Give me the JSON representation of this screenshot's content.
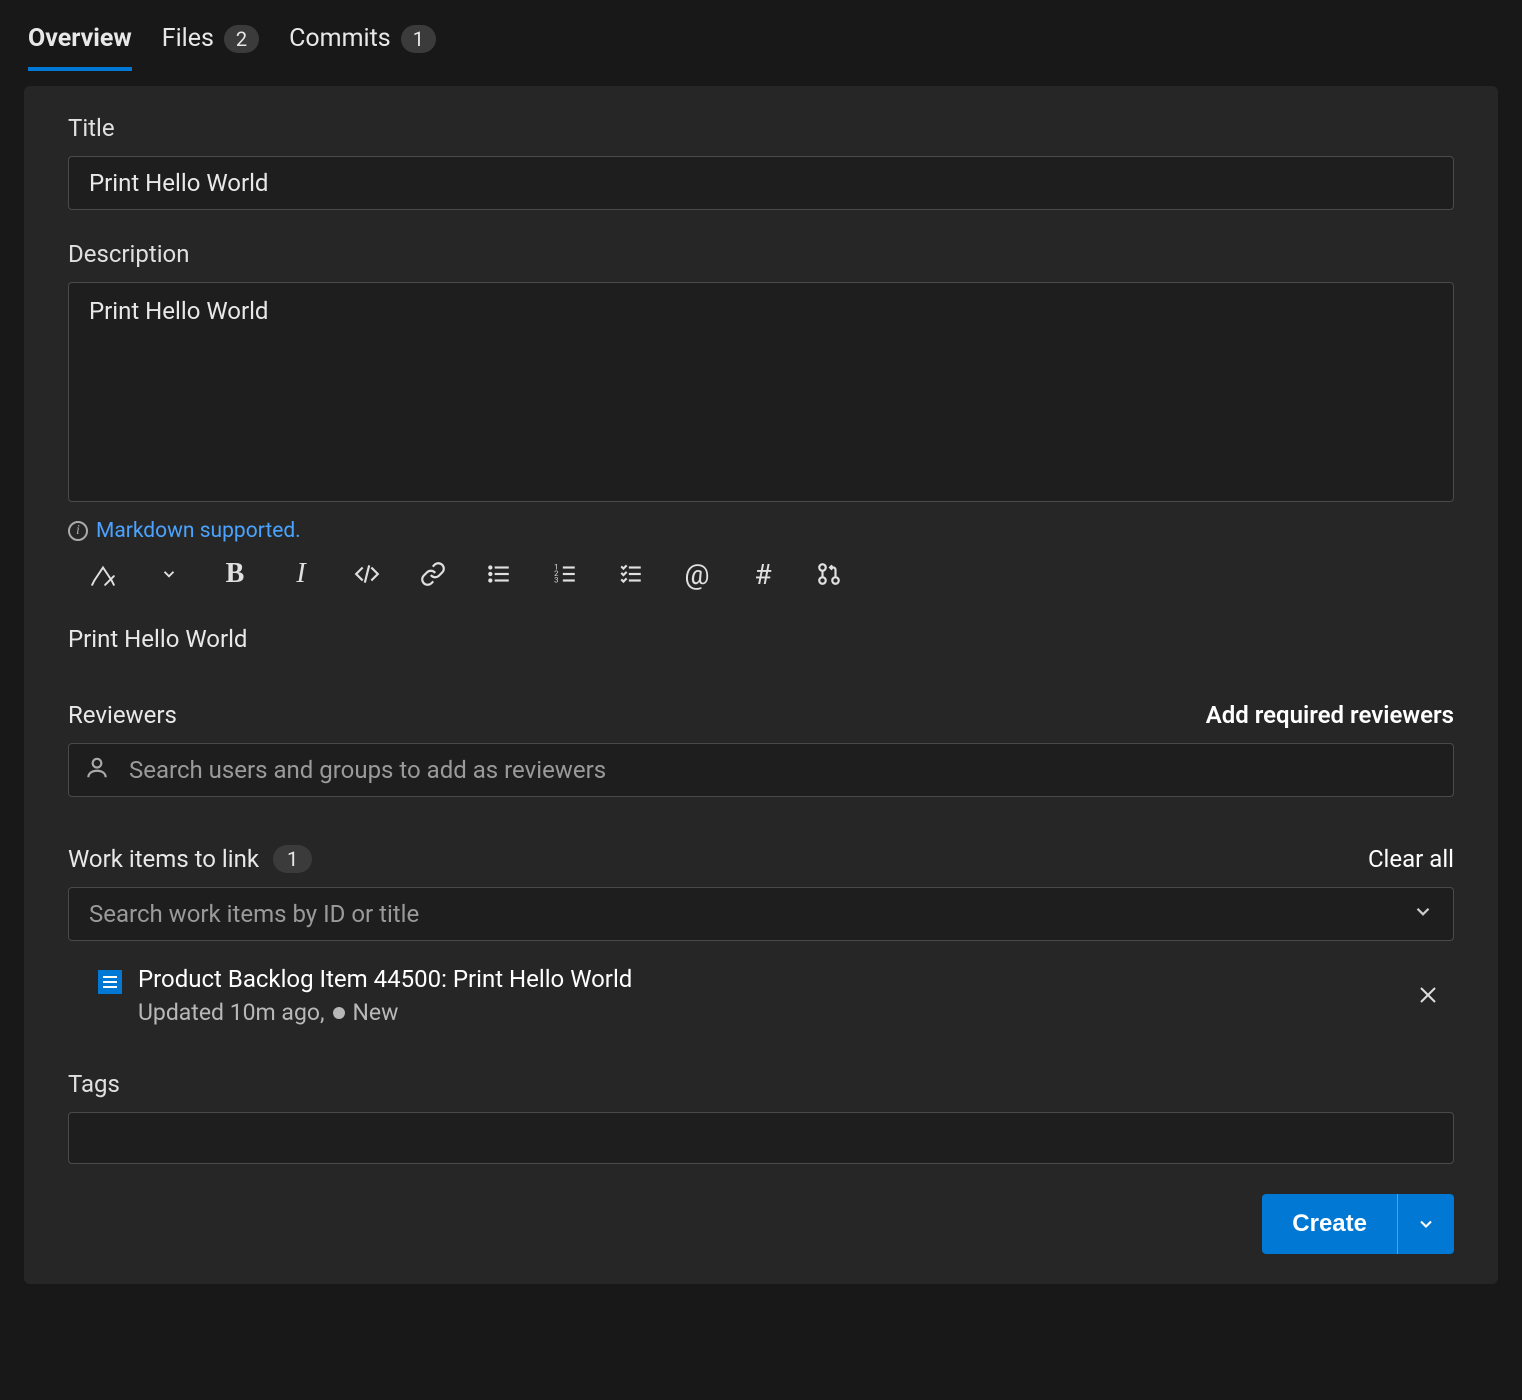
{
  "tabs": {
    "overview": "Overview",
    "files": "Files",
    "files_count": "2",
    "commits": "Commits",
    "commits_count": "1"
  },
  "title": {
    "label": "Title",
    "value": "Print Hello World"
  },
  "description": {
    "label": "Description",
    "value": "Print Hello World",
    "markdown_hint": "Markdown supported."
  },
  "preview_text": "Print Hello World",
  "reviewers": {
    "label": "Reviewers",
    "add_required": "Add required reviewers",
    "placeholder": "Search users and groups to add as reviewers"
  },
  "work_items": {
    "label": "Work items to link",
    "count": "1",
    "clear_all": "Clear all",
    "placeholder": "Search work items by ID or title",
    "item": {
      "title": "Product Backlog Item 44500: Print Hello World",
      "updated": "Updated 10m ago,",
      "state": "New"
    }
  },
  "tags": {
    "label": "Tags"
  },
  "footer": {
    "create": "Create"
  }
}
